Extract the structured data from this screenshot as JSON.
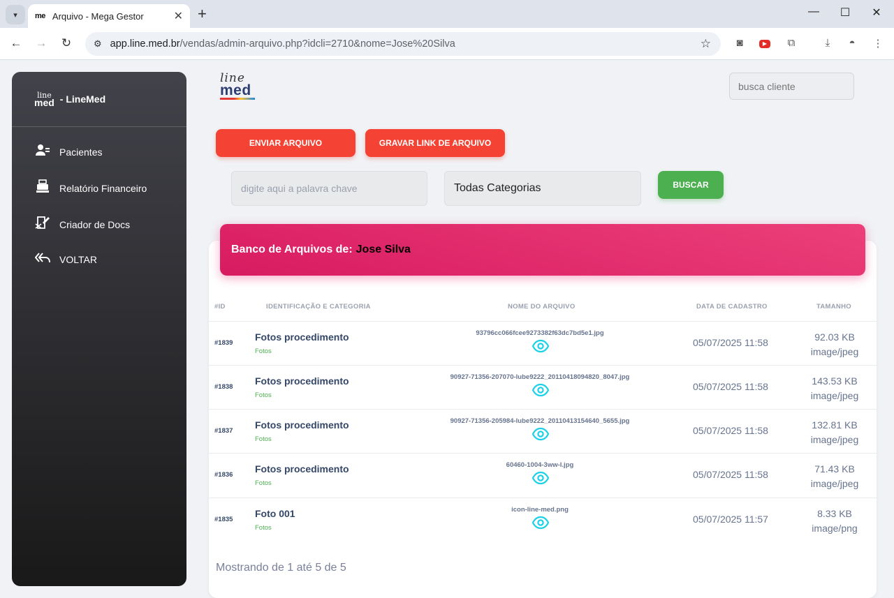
{
  "browser": {
    "tab_favicon": "me",
    "tab_title": "Arquivo - Mega Gestor",
    "url_host": "app.line.med.br",
    "url_path": "/vendas/admin-arquivo.php?idcli=2710&nome=Jose%20Silva"
  },
  "sidebar": {
    "logo_top": "line",
    "logo_bottom": "med",
    "brand": "- LineMed",
    "items": [
      {
        "label": "Pacientes",
        "icon": "users-icon"
      },
      {
        "label": "Relatório Financeiro",
        "icon": "cash-register-icon"
      },
      {
        "label": "Criador de Docs",
        "icon": "document-sign-icon"
      },
      {
        "label": "VOLTAR",
        "icon": "reply-all-icon"
      }
    ]
  },
  "header": {
    "logo_top": "line",
    "logo_bottom": "med",
    "search_placeholder": "busca cliente"
  },
  "actions": {
    "send_file": "ENVIAR ARQUIVO",
    "save_link": "GRAVAR LINK DE ARQUIVO"
  },
  "filters": {
    "keyword_placeholder": "digite aqui a palavra chave",
    "category_selected": "Todas Categorias",
    "search_button": "BUSCAR"
  },
  "card": {
    "title": "Banco de Arquivos de:",
    "client_name": "Jose Silva"
  },
  "table": {
    "headers": [
      "#ID",
      "IDENTIFICAÇÃO E CATEGORIA",
      "NOME DO ARQUIVO",
      "DATA DE CADASTRO",
      "TAMANHO"
    ],
    "rows": [
      {
        "id": "#1839",
        "name": "Fotos procedimento",
        "category": "Fotos",
        "file": "93796cc066fcee9273382f63dc7bd5e1.jpg",
        "date": "05/07/2025 11:58",
        "size": "92.03 KB",
        "type": "image/jpeg"
      },
      {
        "id": "#1838",
        "name": "Fotos procedimento",
        "category": "Fotos",
        "file": "90927-71356-207070-lube9222_20110418094820_8047.jpg",
        "date": "05/07/2025 11:58",
        "size": "143.53 KB",
        "type": "image/jpeg"
      },
      {
        "id": "#1837",
        "name": "Fotos procedimento",
        "category": "Fotos",
        "file": "90927-71356-205984-lube9222_20110413154640_5655.jpg",
        "date": "05/07/2025 11:58",
        "size": "132.81 KB",
        "type": "image/jpeg"
      },
      {
        "id": "#1836",
        "name": "Fotos procedimento",
        "category": "Fotos",
        "file": "60460-1004-3ww-l.jpg",
        "date": "05/07/2025 11:58",
        "size": "71.43 KB",
        "type": "image/jpeg"
      },
      {
        "id": "#1835",
        "name": "Foto 001",
        "category": "Fotos",
        "file": "icon-line-med.png",
        "date": "05/07/2025 11:57",
        "size": "8.33 KB",
        "type": "image/png"
      }
    ],
    "footer": "Mostrando de 1 até 5 de 5"
  },
  "colors": {
    "accent_red": "#f44335",
    "accent_green": "#4caf50",
    "header_pink": "#d81b60",
    "eye_cyan": "#1ed1e6"
  }
}
